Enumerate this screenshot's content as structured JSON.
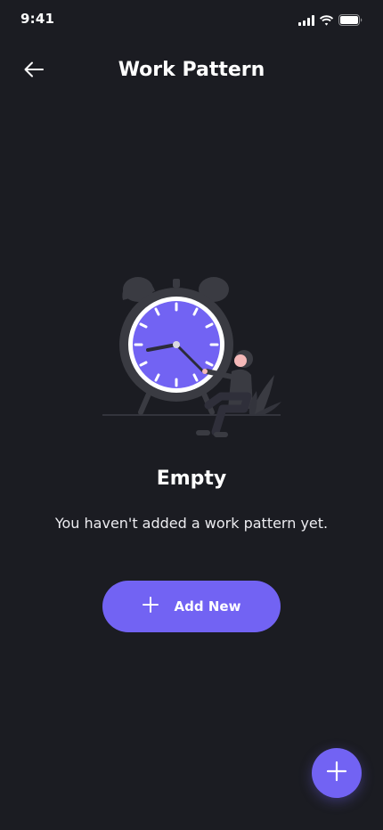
{
  "status_bar": {
    "time": "9:41",
    "icons": [
      "cellular-signal-icon",
      "wifi-icon",
      "battery-icon"
    ]
  },
  "header": {
    "title": "Work Pattern",
    "back_icon": "arrow-left-icon"
  },
  "empty_state": {
    "illustration": "alarm-clock-with-person",
    "title": "Empty",
    "message": "You haven't added a work pattern yet."
  },
  "add_button": {
    "label": "Add New",
    "icon": "plus-icon"
  },
  "fab": {
    "icon": "plus-icon"
  },
  "colors": {
    "background": "#1b1c22",
    "accent": "#7263f3",
    "text": "#ffffff"
  }
}
